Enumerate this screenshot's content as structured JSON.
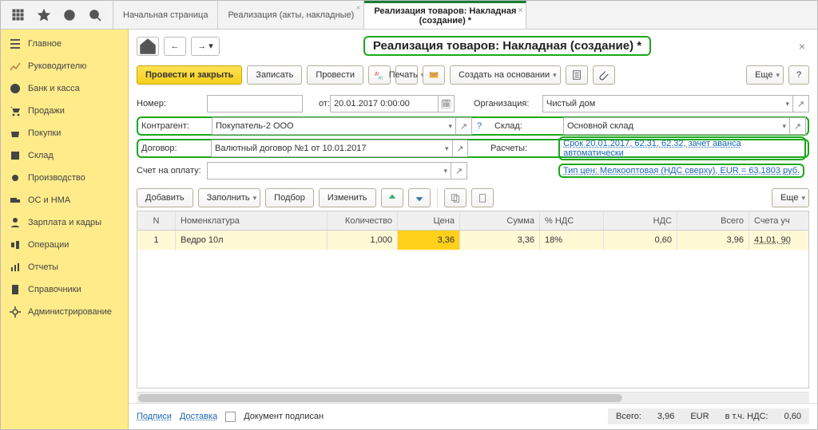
{
  "header": {
    "tabs": [
      {
        "label": "Начальная страница"
      },
      {
        "label": "Реализация (акты, накладные)"
      },
      {
        "label1": "Реализация товаров: Накладная",
        "label2": "(создание) *",
        "active": true
      }
    ]
  },
  "nav": {
    "items": [
      {
        "label": "Главное",
        "icon": "menu"
      },
      {
        "label": "Руководителю",
        "icon": "chart"
      },
      {
        "label": "Банк и касса",
        "icon": "coin"
      },
      {
        "label": "Продажи",
        "icon": "cart"
      },
      {
        "label": "Покупки",
        "icon": "basket"
      },
      {
        "label": "Склад",
        "icon": "box"
      },
      {
        "label": "Производство",
        "icon": "gear"
      },
      {
        "label": "ОС и НМА",
        "icon": "truck"
      },
      {
        "label": "Зарплата и кадры",
        "icon": "people"
      },
      {
        "label": "Операции",
        "icon": "ops"
      },
      {
        "label": "Отчеты",
        "icon": "report"
      },
      {
        "label": "Справочники",
        "icon": "book"
      },
      {
        "label": "Администрирование",
        "icon": "admin"
      }
    ]
  },
  "page": {
    "title": "Реализация товаров: Накладная (создание) *",
    "toolbar": {
      "post_close": "Провести и закрыть",
      "write": "Записать",
      "post": "Провести",
      "print": "Печать",
      "create_based": "Создать на основании",
      "more": "Еще",
      "help": "?"
    },
    "fields": {
      "number_lbl": "Номер:",
      "number": "",
      "date_lbl": "от:",
      "date": "20.01.2017  0:00:00",
      "org_lbl": "Организация:",
      "org": "Чистый дом",
      "contr_lbl": "Контрагент:",
      "contr": "Покупатель-2 ООО",
      "contract_lbl": "Договор:",
      "contract": "Валютный договор №1 от 10.01.2017",
      "sklad_lbl": "Склад:",
      "sklad": "Основной склад",
      "invoice_lbl": "Счет на оплату:",
      "invoice": "",
      "calc_lbl": "Расчеты:",
      "calc_link": "Срок 20.01.2017, 62.31, 62.32, зачет аванса автоматически",
      "price_link": "Тип цен: Мелкооптовая (НДС сверху), EUR = 63,1803 руб."
    },
    "table_toolbar": {
      "add": "Добавить",
      "fill": "Заполнить",
      "pick": "Подбор",
      "edit": "Изменить",
      "more": "Еще"
    },
    "table": {
      "headers": {
        "n": "N",
        "item": "Номенклатура",
        "qty": "Количество",
        "price": "Цена",
        "sum": "Сумма",
        "vatp": "% НДС",
        "vat": "НДС",
        "total": "Всего",
        "acc": "Счета уч"
      },
      "rows": [
        {
          "n": "1",
          "item": "Ведро 10л",
          "qty": "1,000",
          "price": "3,36",
          "sum": "3,36",
          "vatp": "18%",
          "vat": "0,60",
          "total": "3,96",
          "acc": "41.01, 90"
        }
      ]
    },
    "footer": {
      "signatures": "Подписи",
      "delivery": "Доставка",
      "signed_lbl": "Документ подписан",
      "total_lbl": "Всего:",
      "total_val": "3,96",
      "currency": "EUR",
      "vat_lbl": "в т.ч. НДС:",
      "vat_val": "0,60"
    }
  }
}
